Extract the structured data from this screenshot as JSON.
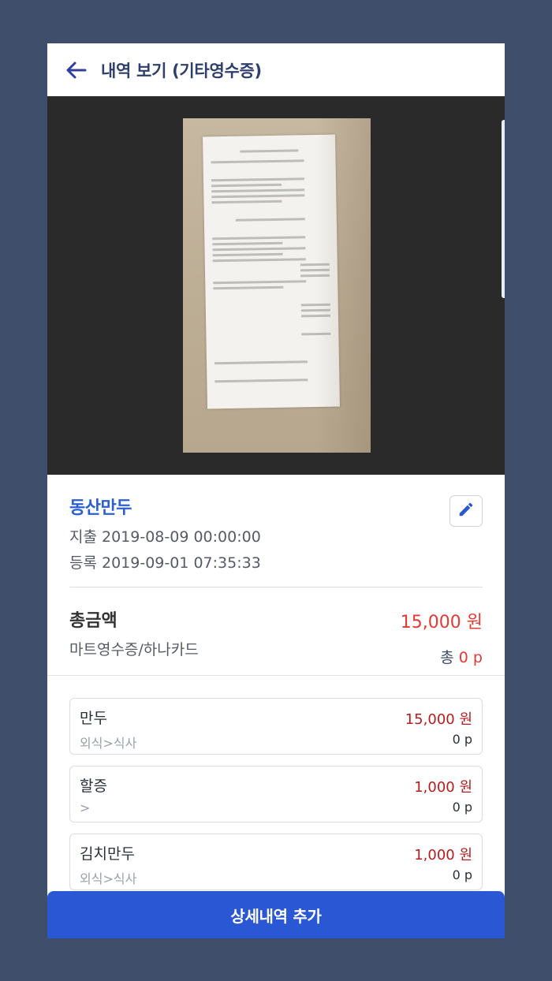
{
  "header": {
    "title": "내역 보기 (기타영수증)",
    "back_icon": "arrow-left-icon"
  },
  "receipt_photo": {
    "alt": "영수증 이미지"
  },
  "store": {
    "name": "동산만두",
    "expense_date": "지출 2019-08-09 00:00:00",
    "register_date": "등록 2019-09-01 07:35:33",
    "edit_icon": "pencil-icon"
  },
  "total": {
    "label": "총금액",
    "sub": "마트영수증/하나카드",
    "amount": "15,000 원",
    "points_prefix": "총",
    "points_value": "0 p"
  },
  "items": [
    {
      "name": "만두",
      "category": "외식>식사",
      "amount": "15,000 원",
      "points": "0 p"
    },
    {
      "name": "할증",
      "category": ">",
      "amount": "1,000 원",
      "points": "0 p"
    },
    {
      "name": "김치만두",
      "category": "외식>식사",
      "amount": "1,000 원",
      "points": "0 p"
    }
  ],
  "add_button": {
    "label": "상세내역 추가"
  },
  "colors": {
    "accent": "#2a57d3",
    "amount_red": "#e53935",
    "frame_bg": "#3e4e6b"
  }
}
